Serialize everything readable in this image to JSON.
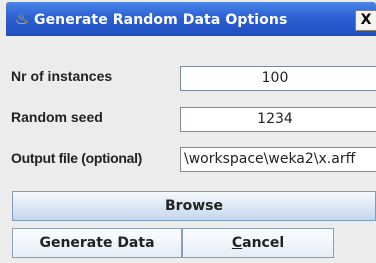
{
  "window": {
    "title": "Generate Random Data Options",
    "close_label": "X"
  },
  "form": {
    "instances_label": "Nr of instances",
    "instances_value": "100",
    "seed_label": "Random seed",
    "seed_value": "1234",
    "output_label": "Output file (optional)",
    "output_value": "\\workspace\\weka2\\x.arff"
  },
  "buttons": {
    "browse": "Browse",
    "generate": "Generate Data",
    "cancel_mnemonic": "C",
    "cancel_rest": "ancel"
  }
}
